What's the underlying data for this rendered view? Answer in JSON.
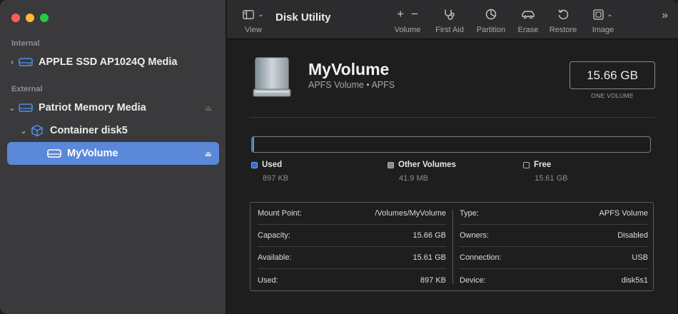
{
  "toolbar": {
    "view_label": "View",
    "title": "Disk Utility",
    "volume_label": "Volume",
    "first_aid_label": "First Aid",
    "partition_label": "Partition",
    "erase_label": "Erase",
    "restore_label": "Restore",
    "image_label": "Image"
  },
  "sidebar": {
    "internal_label": "Internal",
    "external_label": "External",
    "items": [
      {
        "label": "APPLE SSD AP1024Q Media"
      },
      {
        "label": "Patriot Memory Media"
      },
      {
        "label": "Container disk5"
      },
      {
        "label": "MyVolume"
      }
    ]
  },
  "volume": {
    "name": "MyVolume",
    "subtitle": "APFS Volume • APFS",
    "capacity": "15.66 GB",
    "capacity_caption": "ONE VOLUME"
  },
  "usage": {
    "used_fraction": 0.0001,
    "other_fraction": 0.0027,
    "legend": [
      {
        "label": "Used",
        "value": "897 KB",
        "color": "#2f6fd0"
      },
      {
        "label": "Other Volumes",
        "value": "41.9 MB",
        "color": "#8a8a8a"
      },
      {
        "label": "Free",
        "value": "15.61 GB",
        "color": "#1e1e1e"
      }
    ]
  },
  "info": {
    "left": [
      {
        "key": "Mount Point:",
        "value": "/Volumes/MyVolume"
      },
      {
        "key": "Capacity:",
        "value": "15.66 GB"
      },
      {
        "key": "Available:",
        "value": "15.61 GB"
      },
      {
        "key": "Used:",
        "value": "897 KB"
      }
    ],
    "right": [
      {
        "key": "Type:",
        "value": "APFS Volume"
      },
      {
        "key": "Owners:",
        "value": "Disabled"
      },
      {
        "key": "Connection:",
        "value": "USB"
      },
      {
        "key": "Device:",
        "value": "disk5s1"
      }
    ]
  }
}
